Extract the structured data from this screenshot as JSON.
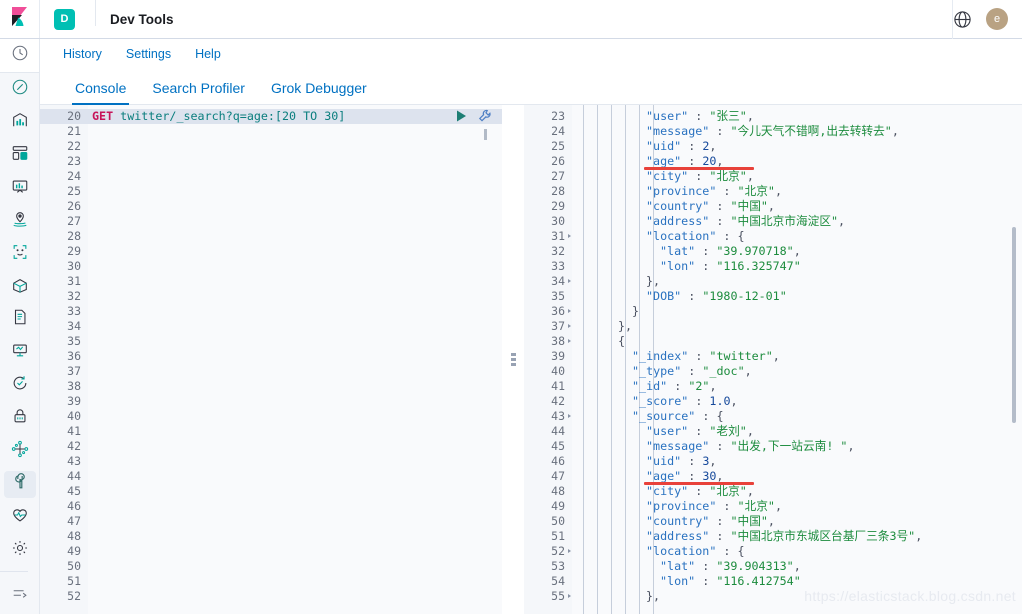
{
  "header": {
    "logo_icon": "kibana-logo-icon",
    "app_badge": "D",
    "title": "Dev Tools",
    "globe_icon": "globe-icon",
    "avatar_initial": "e"
  },
  "sidebar": {
    "items": [
      {
        "name": "recently-viewed",
        "icon": "clock-icon"
      },
      {
        "name": "discover",
        "icon": "compass-icon"
      },
      {
        "name": "visualize",
        "icon": "bar-chart-icon"
      },
      {
        "name": "dashboard",
        "icon": "dashboard-grid-icon"
      },
      {
        "name": "canvas",
        "icon": "presentation-icon"
      },
      {
        "name": "maps",
        "icon": "map-pin-icon"
      },
      {
        "name": "machine-learning",
        "icon": "brackets-dots-icon"
      },
      {
        "name": "infrastructure",
        "icon": "cube-icon"
      },
      {
        "name": "logs",
        "icon": "document-icon"
      },
      {
        "name": "apm",
        "icon": "monitor-icon"
      },
      {
        "name": "uptime",
        "icon": "uptime-check-icon"
      },
      {
        "name": "siem",
        "icon": "lock-icon"
      },
      {
        "name": "graph",
        "icon": "graph-nodes-icon"
      },
      {
        "name": "dev-tools",
        "icon": "wrench-icon"
      },
      {
        "name": "monitoring",
        "icon": "heartbeat-icon"
      },
      {
        "name": "management",
        "icon": "gear-icon"
      }
    ],
    "collapse_icon": "collapse-arrow-icon",
    "selected": "dev-tools"
  },
  "submenu": {
    "items": [
      {
        "label": "History",
        "name": "history-link"
      },
      {
        "label": "Settings",
        "name": "settings-link"
      },
      {
        "label": "Help",
        "name": "help-link"
      }
    ]
  },
  "tabs": {
    "items": [
      {
        "label": "Console",
        "active": true
      },
      {
        "label": "Search Profiler",
        "active": false
      },
      {
        "label": "Grok Debugger",
        "active": false
      }
    ]
  },
  "request_editor": {
    "play_icon": "play-icon",
    "wrench_icon": "wrench-icon",
    "first_line_number": 20,
    "last_line_number": 52,
    "lines": [
      {
        "n": 20,
        "highlight": true,
        "tokens": [
          {
            "t": "GET ",
            "c": "k-method"
          },
          {
            "t": "twitter/_search?q=age:[20 TO 30]",
            "c": "k-url"
          }
        ]
      },
      {
        "n": 21,
        "tokens": []
      },
      {
        "n": 22,
        "tokens": []
      },
      {
        "n": 23,
        "tokens": []
      },
      {
        "n": 24,
        "tokens": []
      },
      {
        "n": 25,
        "tokens": []
      },
      {
        "n": 26,
        "tokens": []
      },
      {
        "n": 27,
        "tokens": []
      },
      {
        "n": 28,
        "tokens": []
      },
      {
        "n": 29,
        "tokens": []
      },
      {
        "n": 30,
        "tokens": []
      },
      {
        "n": 31,
        "tokens": []
      },
      {
        "n": 32,
        "tokens": []
      },
      {
        "n": 33,
        "tokens": []
      },
      {
        "n": 34,
        "tokens": []
      },
      {
        "n": 35,
        "tokens": []
      },
      {
        "n": 36,
        "tokens": []
      },
      {
        "n": 37,
        "tokens": []
      },
      {
        "n": 38,
        "tokens": []
      },
      {
        "n": 39,
        "tokens": []
      },
      {
        "n": 40,
        "tokens": []
      },
      {
        "n": 41,
        "tokens": []
      },
      {
        "n": 42,
        "tokens": []
      },
      {
        "n": 43,
        "tokens": []
      },
      {
        "n": 44,
        "tokens": []
      },
      {
        "n": 45,
        "tokens": []
      },
      {
        "n": 46,
        "tokens": []
      },
      {
        "n": 47,
        "tokens": []
      },
      {
        "n": 48,
        "tokens": []
      },
      {
        "n": 49,
        "tokens": []
      },
      {
        "n": 50,
        "tokens": []
      },
      {
        "n": 51,
        "tokens": []
      },
      {
        "n": 52,
        "tokens": []
      }
    ]
  },
  "response_editor": {
    "first_line_number": 23,
    "last_line_number": 55,
    "lines": [
      {
        "n": 23,
        "indent": 5,
        "fold": false,
        "tokens": [
          {
            "t": "\"user\"",
            "c": "k-key"
          },
          {
            "t": " : ",
            "c": "k-punc"
          },
          {
            "t": "\"张三\"",
            "c": "k-str"
          },
          {
            "t": ",",
            "c": "k-punc"
          }
        ]
      },
      {
        "n": 24,
        "indent": 5,
        "fold": false,
        "tokens": [
          {
            "t": "\"message\"",
            "c": "k-key"
          },
          {
            "t": " : ",
            "c": "k-punc"
          },
          {
            "t": "\"今儿天气不错啊,出去转转去\"",
            "c": "k-str"
          },
          {
            "t": ",",
            "c": "k-punc"
          }
        ]
      },
      {
        "n": 25,
        "indent": 5,
        "fold": false,
        "tokens": [
          {
            "t": "\"uid\"",
            "c": "k-key"
          },
          {
            "t": " : ",
            "c": "k-punc"
          },
          {
            "t": "2",
            "c": "k-num"
          },
          {
            "t": ",",
            "c": "k-punc"
          }
        ]
      },
      {
        "n": 26,
        "indent": 5,
        "fold": false,
        "tokens": [
          {
            "t": "\"age\"",
            "c": "k-key"
          },
          {
            "t": " : ",
            "c": "k-punc"
          },
          {
            "t": "20",
            "c": "k-num"
          },
          {
            "t": ",",
            "c": "k-punc"
          }
        ]
      },
      {
        "n": 27,
        "indent": 5,
        "fold": false,
        "tokens": [
          {
            "t": "\"city\"",
            "c": "k-key"
          },
          {
            "t": " : ",
            "c": "k-punc"
          },
          {
            "t": "\"北京\"",
            "c": "k-str"
          },
          {
            "t": ",",
            "c": "k-punc"
          }
        ]
      },
      {
        "n": 28,
        "indent": 5,
        "fold": false,
        "tokens": [
          {
            "t": "\"province\"",
            "c": "k-key"
          },
          {
            "t": " : ",
            "c": "k-punc"
          },
          {
            "t": "\"北京\"",
            "c": "k-str"
          },
          {
            "t": ",",
            "c": "k-punc"
          }
        ]
      },
      {
        "n": 29,
        "indent": 5,
        "fold": false,
        "tokens": [
          {
            "t": "\"country\"",
            "c": "k-key"
          },
          {
            "t": " : ",
            "c": "k-punc"
          },
          {
            "t": "\"中国\"",
            "c": "k-str"
          },
          {
            "t": ",",
            "c": "k-punc"
          }
        ]
      },
      {
        "n": 30,
        "indent": 5,
        "fold": false,
        "tokens": [
          {
            "t": "\"address\"",
            "c": "k-key"
          },
          {
            "t": " : ",
            "c": "k-punc"
          },
          {
            "t": "\"中国北京市海淀区\"",
            "c": "k-str"
          },
          {
            "t": ",",
            "c": "k-punc"
          }
        ]
      },
      {
        "n": 31,
        "indent": 5,
        "fold": true,
        "tokens": [
          {
            "t": "\"location\"",
            "c": "k-key"
          },
          {
            "t": " : {",
            "c": "k-punc"
          }
        ]
      },
      {
        "n": 32,
        "indent": 6,
        "fold": false,
        "tokens": [
          {
            "t": "\"lat\"",
            "c": "k-key"
          },
          {
            "t": " : ",
            "c": "k-punc"
          },
          {
            "t": "\"39.970718\"",
            "c": "k-str"
          },
          {
            "t": ",",
            "c": "k-punc"
          }
        ]
      },
      {
        "n": 33,
        "indent": 6,
        "fold": false,
        "tokens": [
          {
            "t": "\"lon\"",
            "c": "k-key"
          },
          {
            "t": " : ",
            "c": "k-punc"
          },
          {
            "t": "\"116.325747\"",
            "c": "k-str"
          }
        ]
      },
      {
        "n": 34,
        "indent": 5,
        "fold": true,
        "tokens": [
          {
            "t": "},",
            "c": "k-punc"
          }
        ]
      },
      {
        "n": 35,
        "indent": 5,
        "fold": false,
        "tokens": [
          {
            "t": "\"DOB\"",
            "c": "k-key"
          },
          {
            "t": " : ",
            "c": "k-punc"
          },
          {
            "t": "\"1980-12-01\"",
            "c": "k-str"
          }
        ]
      },
      {
        "n": 36,
        "indent": 4,
        "fold": true,
        "tokens": [
          {
            "t": "}",
            "c": "k-punc"
          }
        ]
      },
      {
        "n": 37,
        "indent": 3,
        "fold": true,
        "tokens": [
          {
            "t": "},",
            "c": "k-punc"
          }
        ]
      },
      {
        "n": 38,
        "indent": 3,
        "fold": true,
        "tokens": [
          {
            "t": "{",
            "c": "k-punc"
          }
        ]
      },
      {
        "n": 39,
        "indent": 4,
        "fold": false,
        "tokens": [
          {
            "t": "\"_index\"",
            "c": "k-key"
          },
          {
            "t": " : ",
            "c": "k-punc"
          },
          {
            "t": "\"twitter\"",
            "c": "k-str"
          },
          {
            "t": ",",
            "c": "k-punc"
          }
        ]
      },
      {
        "n": 40,
        "indent": 4,
        "fold": false,
        "tokens": [
          {
            "t": "\"_type\"",
            "c": "k-key"
          },
          {
            "t": " : ",
            "c": "k-punc"
          },
          {
            "t": "\"_doc\"",
            "c": "k-str"
          },
          {
            "t": ",",
            "c": "k-punc"
          }
        ]
      },
      {
        "n": 41,
        "indent": 4,
        "fold": false,
        "tokens": [
          {
            "t": "\"_id\"",
            "c": "k-key"
          },
          {
            "t": " : ",
            "c": "k-punc"
          },
          {
            "t": "\"2\"",
            "c": "k-str"
          },
          {
            "t": ",",
            "c": "k-punc"
          }
        ]
      },
      {
        "n": 42,
        "indent": 4,
        "fold": false,
        "tokens": [
          {
            "t": "\"_score\"",
            "c": "k-key"
          },
          {
            "t": " : ",
            "c": "k-punc"
          },
          {
            "t": "1.0",
            "c": "k-num"
          },
          {
            "t": ",",
            "c": "k-punc"
          }
        ]
      },
      {
        "n": 43,
        "indent": 4,
        "fold": true,
        "tokens": [
          {
            "t": "\"_source\"",
            "c": "k-key"
          },
          {
            "t": " : {",
            "c": "k-punc"
          }
        ]
      },
      {
        "n": 44,
        "indent": 5,
        "fold": false,
        "tokens": [
          {
            "t": "\"user\"",
            "c": "k-key"
          },
          {
            "t": " : ",
            "c": "k-punc"
          },
          {
            "t": "\"老刘\"",
            "c": "k-str"
          },
          {
            "t": ",",
            "c": "k-punc"
          }
        ]
      },
      {
        "n": 45,
        "indent": 5,
        "fold": false,
        "tokens": [
          {
            "t": "\"message\"",
            "c": "k-key"
          },
          {
            "t": " : ",
            "c": "k-punc"
          },
          {
            "t": "\"出发,下一站云南! \"",
            "c": "k-str"
          },
          {
            "t": ",",
            "c": "k-punc"
          }
        ]
      },
      {
        "n": 46,
        "indent": 5,
        "fold": false,
        "tokens": [
          {
            "t": "\"uid\"",
            "c": "k-key"
          },
          {
            "t": " : ",
            "c": "k-punc"
          },
          {
            "t": "3",
            "c": "k-num"
          },
          {
            "t": ",",
            "c": "k-punc"
          }
        ]
      },
      {
        "n": 47,
        "indent": 5,
        "fold": false,
        "tokens": [
          {
            "t": "\"age\"",
            "c": "k-key"
          },
          {
            "t": " : ",
            "c": "k-punc"
          },
          {
            "t": "30",
            "c": "k-num"
          },
          {
            "t": ",",
            "c": "k-punc"
          }
        ]
      },
      {
        "n": 48,
        "indent": 5,
        "fold": false,
        "tokens": [
          {
            "t": "\"city\"",
            "c": "k-key"
          },
          {
            "t": " : ",
            "c": "k-punc"
          },
          {
            "t": "\"北京\"",
            "c": "k-str"
          },
          {
            "t": ",",
            "c": "k-punc"
          }
        ]
      },
      {
        "n": 49,
        "indent": 5,
        "fold": false,
        "tokens": [
          {
            "t": "\"province\"",
            "c": "k-key"
          },
          {
            "t": " : ",
            "c": "k-punc"
          },
          {
            "t": "\"北京\"",
            "c": "k-str"
          },
          {
            "t": ",",
            "c": "k-punc"
          }
        ]
      },
      {
        "n": 50,
        "indent": 5,
        "fold": false,
        "tokens": [
          {
            "t": "\"country\"",
            "c": "k-key"
          },
          {
            "t": " : ",
            "c": "k-punc"
          },
          {
            "t": "\"中国\"",
            "c": "k-str"
          },
          {
            "t": ",",
            "c": "k-punc"
          }
        ]
      },
      {
        "n": 51,
        "indent": 5,
        "fold": false,
        "tokens": [
          {
            "t": "\"address\"",
            "c": "k-key"
          },
          {
            "t": " : ",
            "c": "k-punc"
          },
          {
            "t": "\"中国北京市东城区台基厂三条3号\"",
            "c": "k-str"
          },
          {
            "t": ",",
            "c": "k-punc"
          }
        ]
      },
      {
        "n": 52,
        "indent": 5,
        "fold": true,
        "tokens": [
          {
            "t": "\"location\"",
            "c": "k-key"
          },
          {
            "t": " : {",
            "c": "k-punc"
          }
        ]
      },
      {
        "n": 53,
        "indent": 6,
        "fold": false,
        "tokens": [
          {
            "t": "\"lat\"",
            "c": "k-key"
          },
          {
            "t": " : ",
            "c": "k-punc"
          },
          {
            "t": "\"39.904313\"",
            "c": "k-str"
          },
          {
            "t": ",",
            "c": "k-punc"
          }
        ]
      },
      {
        "n": 54,
        "indent": 6,
        "fold": false,
        "tokens": [
          {
            "t": "\"lon\"",
            "c": "k-key"
          },
          {
            "t": " : ",
            "c": "k-punc"
          },
          {
            "t": "\"116.412754\"",
            "c": "k-str"
          }
        ]
      },
      {
        "n": 55,
        "indent": 5,
        "fold": true,
        "tokens": [
          {
            "t": "},",
            "c": "k-punc"
          }
        ]
      }
    ],
    "annotations": [
      {
        "name": "age-20-underline",
        "color": "#e8413a",
        "line": 26
      },
      {
        "name": "age-30-underline",
        "color": "#e8413a",
        "line": 47
      }
    ]
  },
  "watermark": {
    "text": "https://elasticstack.blog.csdn.net"
  },
  "colors": {
    "accent": "#0071c2",
    "teal": "#00bfb3",
    "annotation_red": "#e8413a",
    "avatar": "#b9a283"
  }
}
